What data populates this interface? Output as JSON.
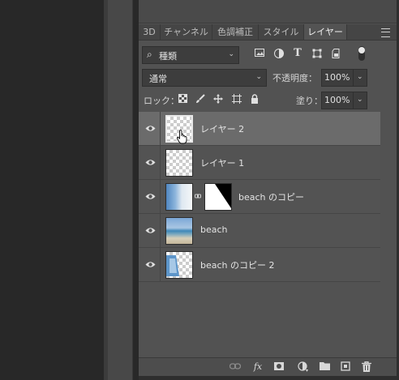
{
  "tabs": [
    {
      "label": "3D"
    },
    {
      "label": "チャンネル"
    },
    {
      "label": "色調補正"
    },
    {
      "label": "スタイル"
    },
    {
      "label": "レイヤー"
    }
  ],
  "active_tab": "レイヤー",
  "filter": {
    "label": "種類"
  },
  "blend_mode": {
    "value": "通常"
  },
  "opacity": {
    "label": "不透明度：",
    "value": "100%"
  },
  "lock": {
    "label": "ロック："
  },
  "fill": {
    "label": "塗り：",
    "value": "100%"
  },
  "layers": [
    {
      "name": "レイヤー 2",
      "selected": true
    },
    {
      "name": "レイヤー 1",
      "selected": false
    },
    {
      "name": "beach のコピー",
      "selected": false
    },
    {
      "name": "beach",
      "selected": false
    },
    {
      "name": "beach のコピー 2",
      "selected": false
    }
  ],
  "icons": {
    "filter_icons": [
      "image-filter-icon",
      "adjustment-filter-icon",
      "type-filter-icon",
      "shape-filter-icon",
      "smart-object-filter-icon",
      "filter-toggle-icon"
    ],
    "lock_icons": [
      "lock-transparent-pixels-icon",
      "lock-image-pixels-icon",
      "lock-position-icon",
      "lock-artboard-icon",
      "lock-all-icon"
    ],
    "footer_icons": [
      "link-layers-icon",
      "fx-icon",
      "add-mask-icon",
      "new-adjustment-icon",
      "new-group-icon",
      "new-layer-icon",
      "delete-layer-icon"
    ]
  },
  "footer": {
    "fx_label": "fx"
  },
  "glyphs": {
    "type_tool": "T"
  },
  "colors": {
    "panel_bg": "#535353",
    "selected_row": "#6b6b6b"
  }
}
